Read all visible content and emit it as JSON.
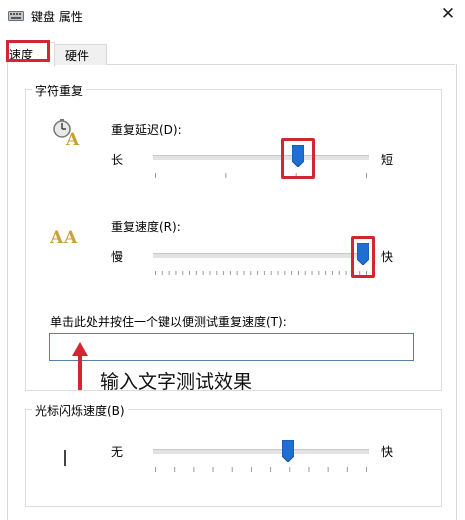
{
  "window": {
    "title": "键盘 属性",
    "close_glyph": "✕",
    "icon": "keyboard-icon"
  },
  "tabs": [
    {
      "label": "速度",
      "selected": true
    },
    {
      "label": "硬件",
      "selected": false
    }
  ],
  "repeat_group": {
    "title": "字符重复",
    "delay": {
      "label": "重复延迟(D):",
      "min_label": "长",
      "max_label": "短",
      "value_fraction": 0.68
    },
    "rate": {
      "label": "重复速度(R):",
      "min_label": "慢",
      "max_label": "快",
      "value_fraction": 1.0
    },
    "test_label": "单击此处并按住一个键以便测试重复速度(T):",
    "test_value": ""
  },
  "annotation": {
    "text": "输入文字测试效果",
    "color": "#d22731"
  },
  "cursor_group": {
    "title": "光标闪烁速度(B)",
    "min_label": "无",
    "max_label": "快",
    "value_fraction": 0.63
  },
  "colors": {
    "highlight": "#d22731",
    "thumb": "#1e6fd1"
  }
}
